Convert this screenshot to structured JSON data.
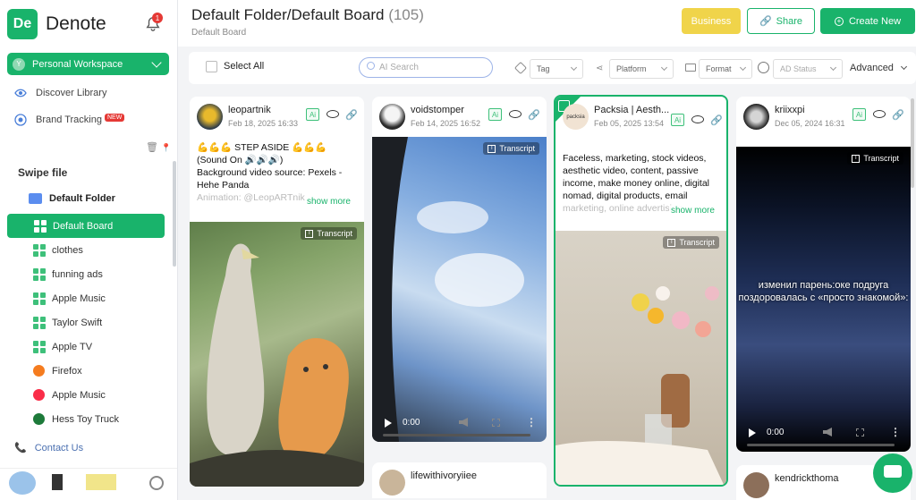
{
  "app": {
    "logo": "De",
    "name": "Denote",
    "notifications": "1"
  },
  "sidebar": {
    "workspace": {
      "avatar": "Y",
      "label": "Personal Workspace"
    },
    "discover": "Discover Library",
    "brand_tracking": "Brand Tracking",
    "new_badge": "NEW",
    "section_title": "Swipe file",
    "folder": "Default Folder",
    "boards": [
      "Default Board",
      "clothes",
      "funning ads",
      "Apple Music",
      "Taylor Swift",
      "Apple TV",
      "Firefox",
      "Apple Music",
      "Hess Toy Truck"
    ],
    "contact": "Contact Us"
  },
  "header": {
    "title": "Default Folder/Default Board",
    "count": "(105)",
    "subtitle": "Default Board",
    "business": "Business",
    "share": "Share",
    "create_new": "Create New"
  },
  "filters": {
    "select_all": "Select All",
    "search_placeholder": "AI Search",
    "tag": "Tag",
    "platform": "Platform",
    "format": "Format",
    "ad_status": "AD Status",
    "advanced": "Advanced"
  },
  "cards": [
    {
      "name": "leopartnik",
      "date": "Feb 18, 2025 16:33",
      "text1": "💪💪💪 STEP ASIDE 💪💪💪",
      "text2": "(Sound On 🔊🔊🔊)",
      "text3": "Background video source: Pexels - Hehe Panda",
      "text4": "Animation: @LeopARTnik",
      "show_more": "show more",
      "transcript": "Transcript"
    },
    {
      "name": "voidstomper",
      "date": "Feb 14, 2025 16:52",
      "transcript": "Transcript",
      "time": "0:00",
      "next_name": "lifewithivoryiiee"
    },
    {
      "name": "Packsia | Aesth...",
      "date": "Feb 05, 2025 13:54",
      "avatar_text": "packsia",
      "text1": "Faceless, marketing, stock videos, aesthetic video, content, passive income, make money online, digital nomad, digital products, email",
      "text2": "marketing, online advertising",
      "show_more": "show more",
      "transcript": "Transcript"
    },
    {
      "name": "kriixxpi",
      "date": "Dec 05, 2024 16:31",
      "transcript": "Transcript",
      "overlay": "изменил парень:оке подруга поздоровалась с «просто знакомой»:",
      "time": "0:00",
      "next_name": "kendrickthoma"
    }
  ],
  "ai_label": "Ai"
}
